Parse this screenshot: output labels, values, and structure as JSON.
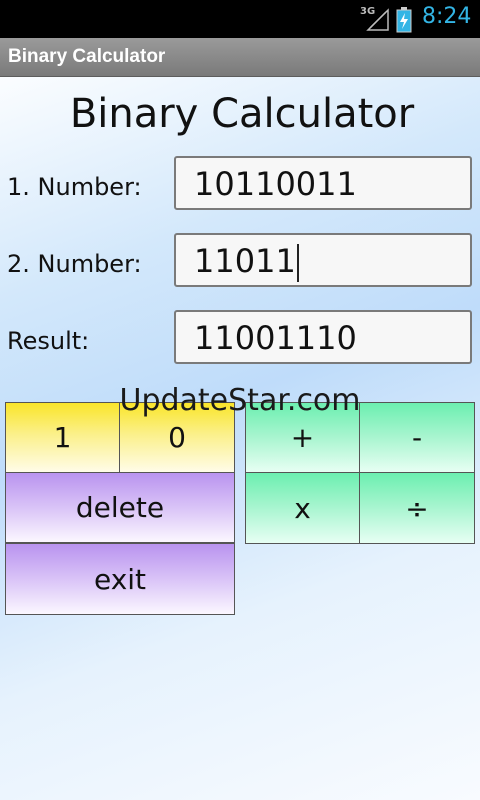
{
  "status_bar": {
    "network": "3G",
    "time": "8:24",
    "time_color": "#33b5e5"
  },
  "title_bar": {
    "title": "Binary Calculator"
  },
  "app": {
    "heading": "Binary Calculator"
  },
  "form": {
    "number1_label": "1. Number:",
    "number1_value": "10110011",
    "number2_label": "2. Number:",
    "number2_value": "11011",
    "result_label": "Result:",
    "result_value": "11001110"
  },
  "keys": {
    "one": "1",
    "zero": "0",
    "plus": "+",
    "minus": "-",
    "delete": "delete",
    "multiply": "x",
    "divide": "÷",
    "exit": "exit"
  },
  "watermark": "UpdateStar.com",
  "colors": {
    "yellow": "#fae52a",
    "green": "#6cefb0",
    "purple": "#b993ef"
  }
}
